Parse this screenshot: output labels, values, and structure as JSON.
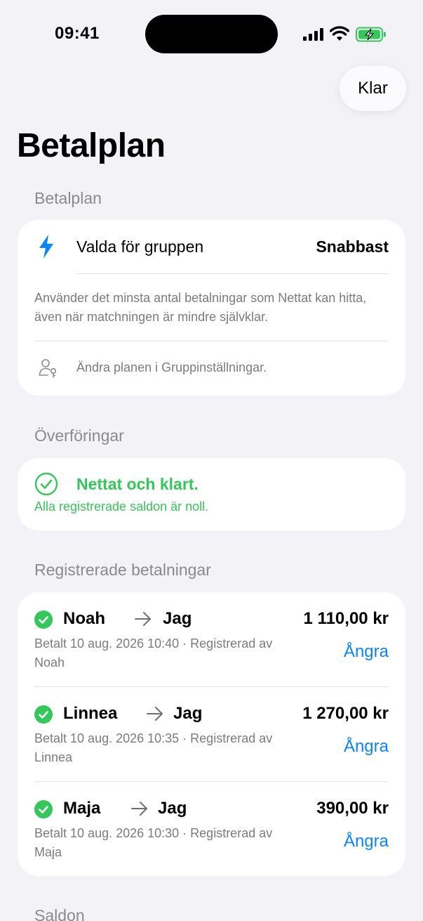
{
  "status_bar": {
    "time": "09:41"
  },
  "nav": {
    "done_label": "Klar"
  },
  "page": {
    "title": "Betalplan"
  },
  "plan_section": {
    "header": "Betalplan",
    "row_label": "Valda för gruppen",
    "row_value": "Snabbast",
    "description": "Använder det minsta antal betalningar som Nettat kan hitta, även när matchningen är mindre självklar.",
    "settings_hint": "Ändra planen i Gruppinställningar."
  },
  "transfers_section": {
    "header": "Överföringar",
    "status_title": "Nettat och klart.",
    "status_subtitle": "Alla registrerade saldon är noll."
  },
  "payments_section": {
    "header": "Registrerade betalningar",
    "undo_label": "Ångra",
    "items": [
      {
        "from": "Noah",
        "to": "Jag",
        "amount": "1 110,00 kr",
        "meta": "Betalt 10 aug. 2026 10:40 · Registrerad av Noah"
      },
      {
        "from": "Linnea",
        "to": "Jag",
        "amount": "1 270,00 kr",
        "meta": "Betalt 10 aug. 2026 10:35 · Registrerad av Linnea"
      },
      {
        "from": "Maja",
        "to": "Jag",
        "amount": "390,00 kr",
        "meta": "Betalt 10 aug. 2026 10:30 · Registrerad av Maja"
      }
    ]
  },
  "balances_section": {
    "header": "Saldon"
  },
  "colors": {
    "accent": "#0A84FF",
    "success": "#34C759",
    "background": "#F2F2F7"
  }
}
